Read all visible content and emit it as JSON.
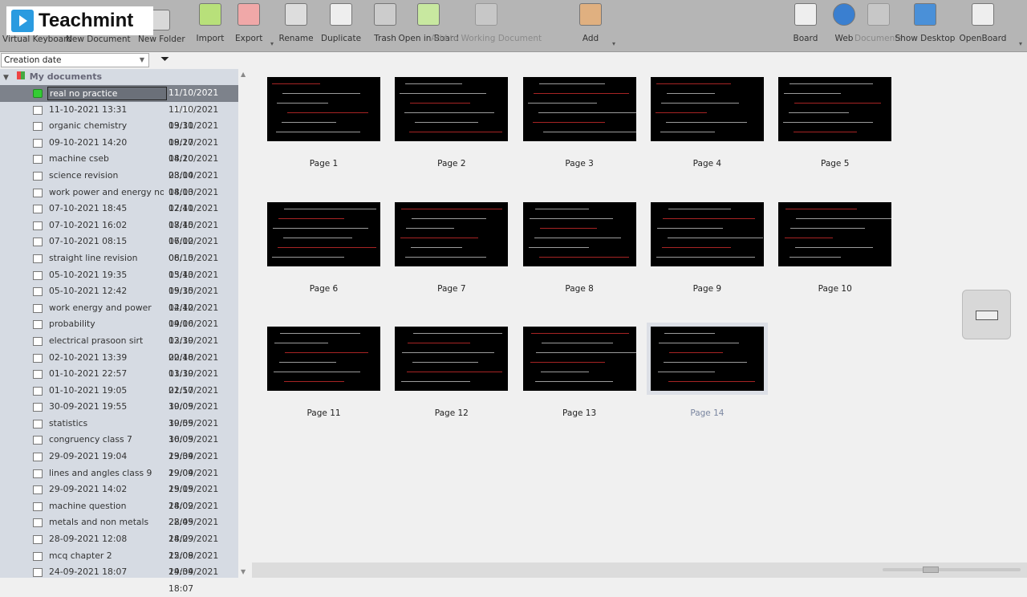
{
  "logo": "Teachmint",
  "toolbar": {
    "hidden": [
      "Virtual Keyboard",
      "New Document",
      "New Folder"
    ],
    "items": [
      {
        "label": "Import",
        "icon": "import-icon",
        "color": "#b8e07a",
        "enabled": true
      },
      {
        "label": "Export",
        "icon": "export-icon",
        "color": "#f0a8a8",
        "enabled": true
      },
      {
        "label": "Rename",
        "icon": "rename-icon",
        "color": "#dddddd",
        "enabled": true
      },
      {
        "label": "Duplicate",
        "icon": "duplicate-icon",
        "color": "#eeeeee",
        "enabled": true
      },
      {
        "label": "Trash",
        "icon": "trash-icon",
        "color": "#cccccc",
        "enabled": true
      },
      {
        "label": "Open in Board",
        "icon": "open-in-board-icon",
        "color": "#c8e8a0",
        "enabled": true
      },
      {
        "label": "Add to Working Document",
        "icon": "add-to-working-document-icon",
        "color": "#dddddd",
        "enabled": false
      },
      {
        "label": "Add",
        "icon": "add-icon",
        "color": "#e0b080",
        "enabled": true
      },
      {
        "label": "Board",
        "icon": "board-icon",
        "color": "#eeeeee",
        "enabled": true
      },
      {
        "label": "Web",
        "icon": "globe-icon",
        "color": "#3a7fd0",
        "enabled": true
      },
      {
        "label": "Documents",
        "icon": "documents-folder-icon",
        "color": "#dddddd",
        "enabled": false
      },
      {
        "label": "Show Desktop",
        "icon": "show-desktop-icon",
        "color": "#4a90d8",
        "enabled": true
      },
      {
        "label": "OpenBoard",
        "icon": "openboard-settings-icon",
        "color": "#eeeeee",
        "enabled": true
      }
    ]
  },
  "sort": {
    "value": "Creation date"
  },
  "tree": {
    "root": "My documents",
    "items": [
      {
        "name": "real no practice",
        "date": "11/10/2021 14:04",
        "selected": true
      },
      {
        "name": "11-10-2021 13:31",
        "date": "11/10/2021 13:31"
      },
      {
        "name": "organic chemistry",
        "date": "09/10/2021 18:27"
      },
      {
        "name": "09-10-2021 14:20",
        "date": "09/10/2021 14:20"
      },
      {
        "name": "machine cseb",
        "date": "08/10/2021 23:04"
      },
      {
        "name": "science revision",
        "date": "08/10/2021 14:03"
      },
      {
        "name": "work power and energy no...",
        "date": "08/10/2021 12:41"
      },
      {
        "name": "07-10-2021 18:45",
        "date": "07/10/2021 18:45"
      },
      {
        "name": "07-10-2021 16:02",
        "date": "07/10/2021 16:02"
      },
      {
        "name": "07-10-2021 08:15",
        "date": "07/10/2021 08:15"
      },
      {
        "name": "straight line revision",
        "date": "06/10/2021 13:43"
      },
      {
        "name": "05-10-2021 19:35",
        "date": "05/10/2021 19:35"
      },
      {
        "name": "05-10-2021 12:42",
        "date": "05/10/2021 12:42"
      },
      {
        "name": "work energy and power",
        "date": "04/10/2021 19:06"
      },
      {
        "name": "probability",
        "date": "04/10/2021 13:39"
      },
      {
        "name": "electrical prasoon sirt",
        "date": "02/10/2021 20:48"
      },
      {
        "name": "02-10-2021 13:39",
        "date": "02/10/2021 13:39"
      },
      {
        "name": "01-10-2021 22:57",
        "date": "01/10/2021 22:57"
      },
      {
        "name": "01-10-2021 19:05",
        "date": "01/10/2021 19:05"
      },
      {
        "name": "30-09-2021 19:55",
        "date": "30/09/2021 19:55"
      },
      {
        "name": "statistics",
        "date": "30/09/2021 16:05"
      },
      {
        "name": "congruency class 7",
        "date": "30/09/2021 13:34"
      },
      {
        "name": "29-09-2021 19:04",
        "date": "29/09/2021 19:04"
      },
      {
        "name": "lines and angles class 9",
        "date": "29/09/2021 15:15"
      },
      {
        "name": "29-09-2021 14:02",
        "date": "29/09/2021 14:02"
      },
      {
        "name": "machine question",
        "date": "28/09/2021 22:45"
      },
      {
        "name": "metals and non metals",
        "date": "28/09/2021 14:29"
      },
      {
        "name": "28-09-2021 12:08",
        "date": "28/09/2021 12:08"
      },
      {
        "name": "mcq chapter 2",
        "date": "25/09/2021 19:34"
      },
      {
        "name": "24-09-2021 18:07",
        "date": "24/09/2021 18:07"
      }
    ]
  },
  "pages": [
    "Page 1",
    "Page 2",
    "Page 3",
    "Page 4",
    "Page 5",
    "Page 6",
    "Page 7",
    "Page 8",
    "Page 9",
    "Page 10",
    "Page 11",
    "Page 12",
    "Page 13",
    "Page 14"
  ],
  "selected_page": "Page 14"
}
